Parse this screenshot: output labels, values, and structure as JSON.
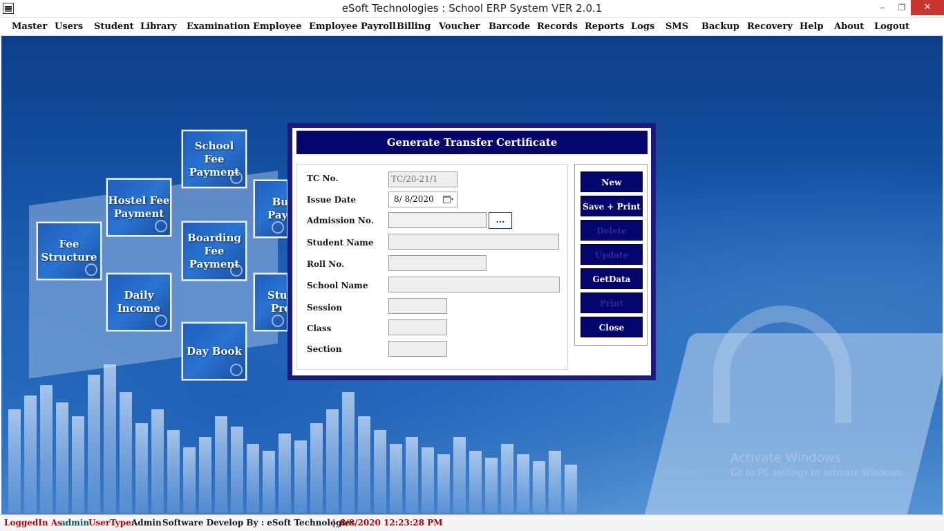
{
  "window": {
    "title": "eSoft Technologies : School ERP System VER 2.0.1",
    "minimize": "‒",
    "restore": "❐",
    "close": "✕"
  },
  "menu": [
    "Master",
    "Users",
    "Student",
    "Library",
    "Examination",
    "Employee",
    "Employee Payroll",
    "Billing",
    "Voucher",
    "Barcode",
    "Records",
    "Reports",
    "Logs",
    "SMS",
    "Backup",
    "Recovery",
    "Help",
    "About",
    "Logout"
  ],
  "tiles": {
    "fee_structure": "Fee Structure",
    "hostel_fee_payment": "Hostel Fee Payment",
    "school_fee_payment": "School Fee Payment",
    "boarding_fee_payment": "Boarding Fee Payment",
    "daily_income": "Daily Income",
    "day_book": "Day Book",
    "bus_payment": "Bus Paym",
    "student_pro": "Stud Pro"
  },
  "dialog": {
    "title": "Generate Transfer Certificate",
    "fields": {
      "tc_no": {
        "label": "TC No.",
        "value": "TC/20-21/1"
      },
      "issue_date": {
        "label": "Issue Date",
        "value": "8/  8/2020"
      },
      "admission_no": {
        "label": "Admission No.",
        "value": "",
        "lookup": "..."
      },
      "student_name": {
        "label": "Student Name",
        "value": ""
      },
      "roll_no": {
        "label": "Roll No.",
        "value": ""
      },
      "school_name": {
        "label": "School Name",
        "value": ""
      },
      "session": {
        "label": "Session",
        "value": ""
      },
      "class": {
        "label": "Class",
        "value": ""
      },
      "section": {
        "label": "Section",
        "value": ""
      }
    },
    "buttons": {
      "new": "New",
      "save_print": "Save + Print",
      "delete": "Delete",
      "update": "Update",
      "getdata": "GetData",
      "print": "Print",
      "close": "Close"
    }
  },
  "watermark": {
    "line1": "Activate Windows",
    "line2": "Go to PC settings to activate Windows."
  },
  "status": {
    "logged_label": "LoggedIn As :",
    "user": "admin",
    "usertype_label": "UserType:",
    "usertype": "Admin",
    "developer": "Software Develop By : eSoft Technologies",
    "separator": "|",
    "datetime": "8/8/2020 12:23:28 PM"
  }
}
